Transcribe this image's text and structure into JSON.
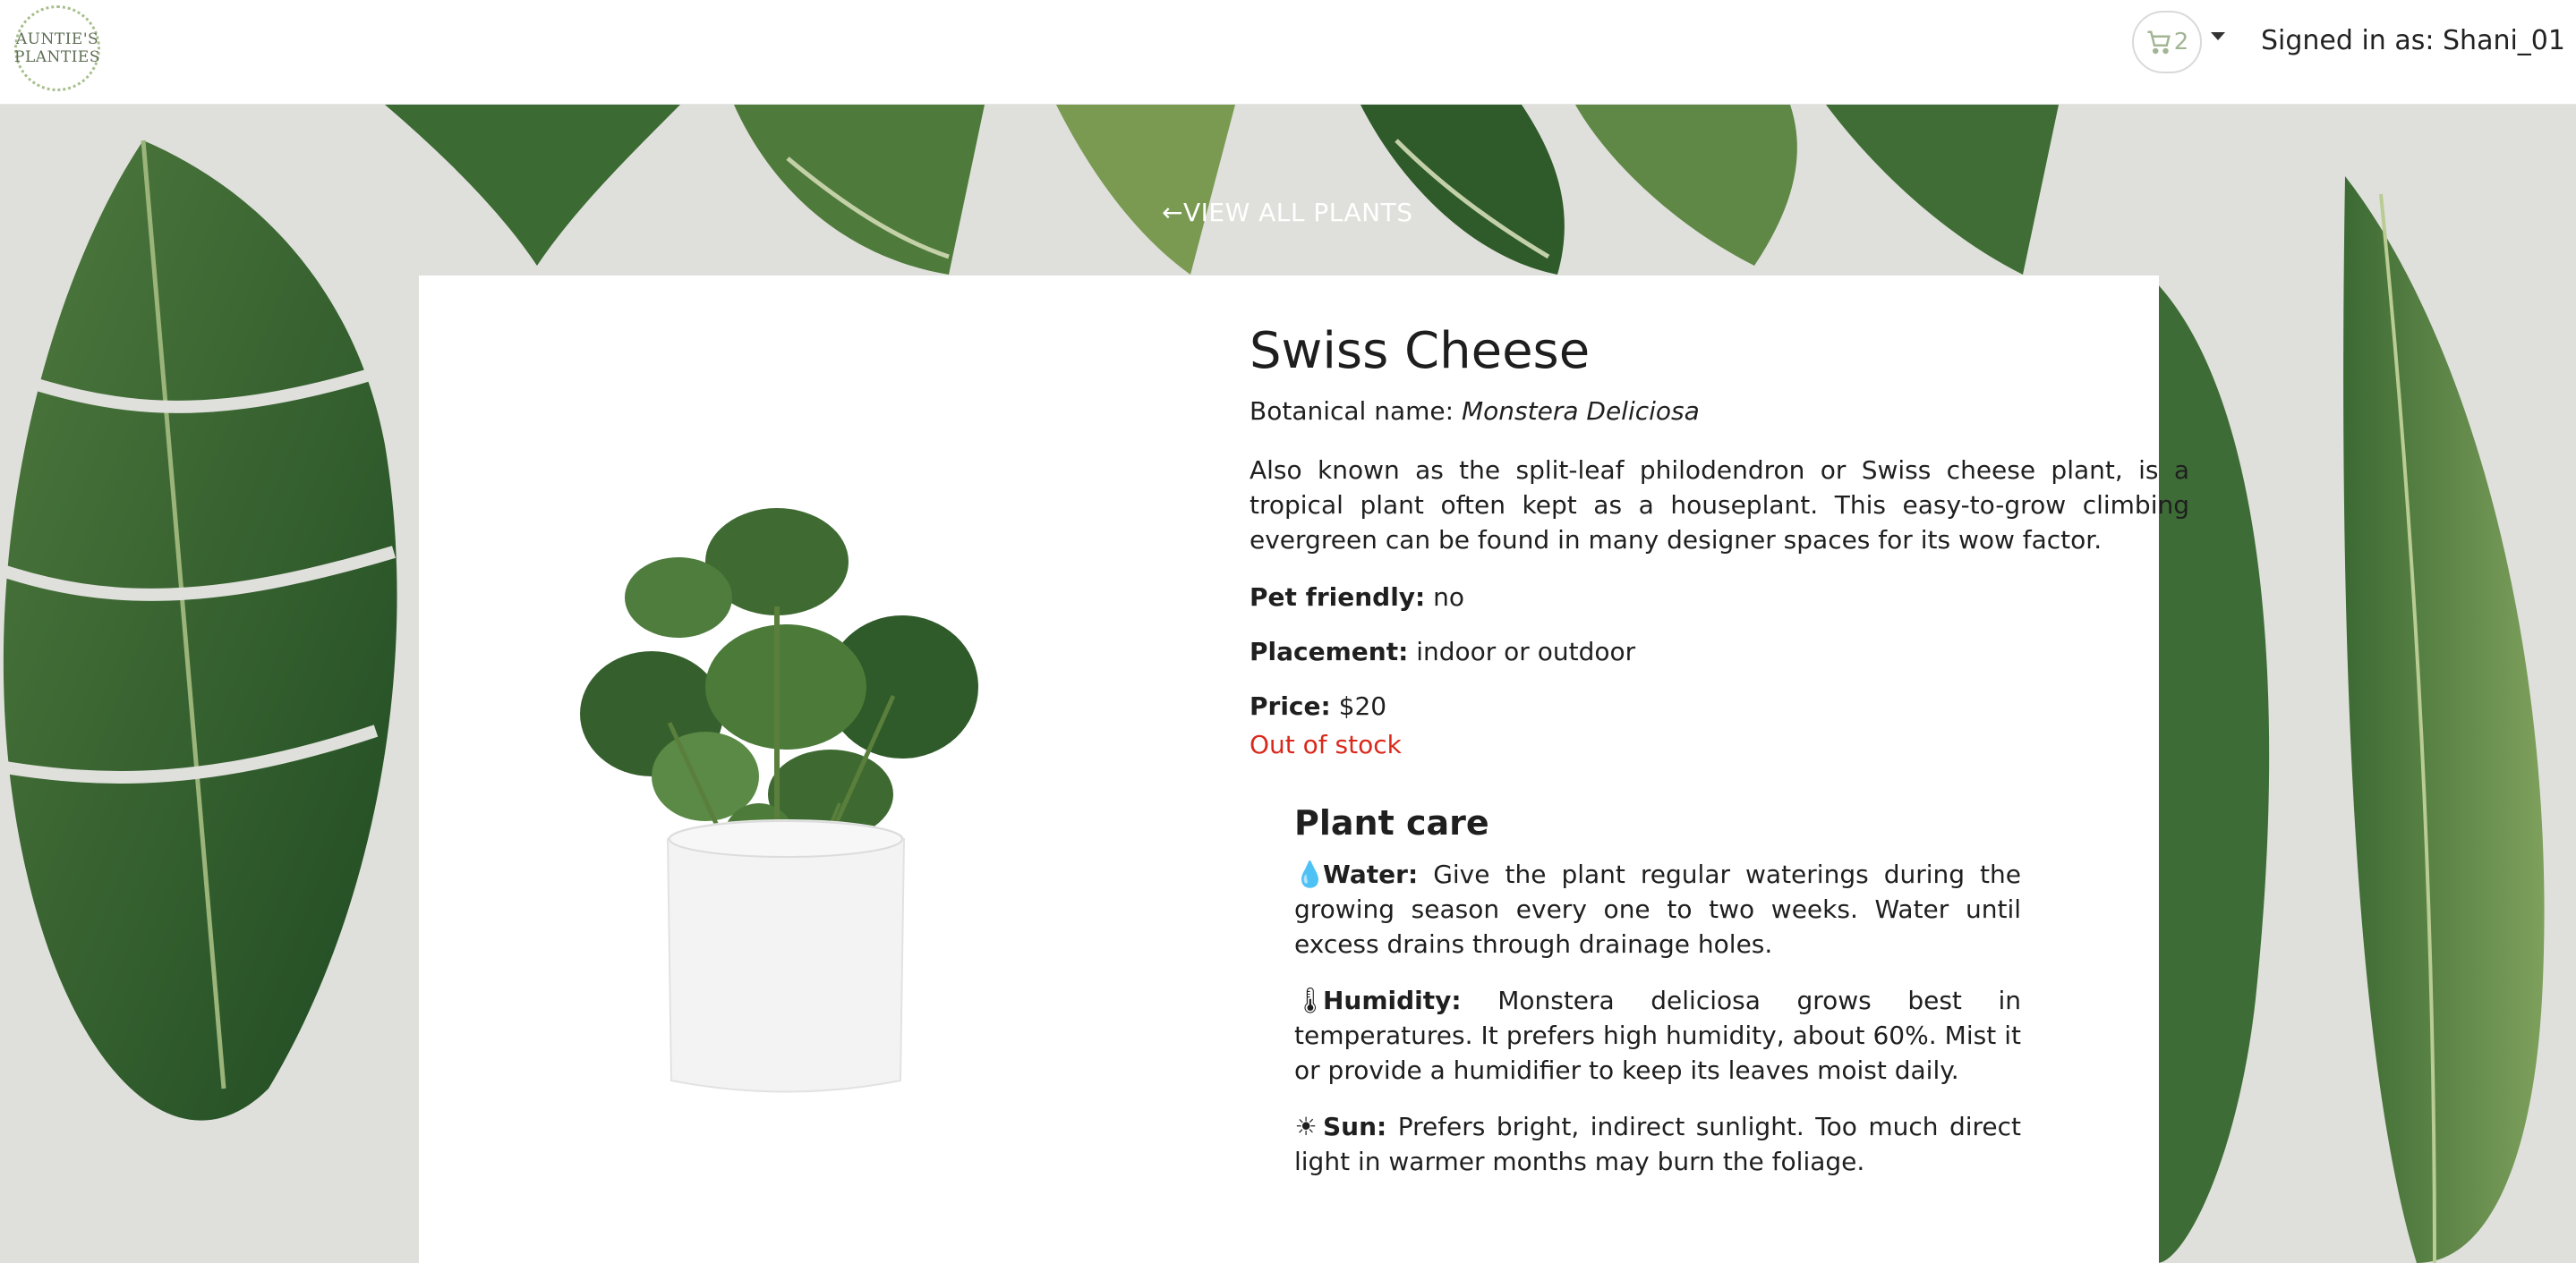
{
  "header": {
    "logo_line1": "AUNTIE'S",
    "logo_line2": "PLANTIES",
    "cart_icon": "cart-icon",
    "cart_count": "2",
    "signed_in": "Signed in as: Shani_01"
  },
  "nav": {
    "back_link": "←VIEW ALL PLANTS"
  },
  "product": {
    "name": "Swiss Cheese",
    "botanical_label": "Botanical name: ",
    "botanical_value": "Monstera Deliciosa",
    "description": "Also known as the split-leaf philodendron or Swiss cheese plant, is a tropical plant often kept as a houseplant. This easy-to-grow climbing evergreen can be found in many designer spaces for its wow factor.",
    "pet_label": "Pet friendly:",
    "pet_value": "no",
    "placement_label": "Placement:",
    "placement_value": "indoor or outdoor",
    "price_label": "Price:",
    "price_value": "$20",
    "stock": "Out of stock"
  },
  "care": {
    "title": "Plant care",
    "water_icon": "💧",
    "water_label": "Water:",
    "water_text": "Give the plant regular waterings during the growing season every one to two weeks. Water until excess drains through drainage holes.",
    "humidity_icon": "🌡",
    "humidity_label": "Humidity:",
    "humidity_text": "Monstera deliciosa grows best in temperatures. It prefers high humidity, about 60%. Mist it or provide a humidifier to keep its leaves moist daily.",
    "sun_icon": "☀",
    "sun_label": "Sun:",
    "sun_text": "Prefers bright, indirect sunlight. Too much direct light in warmer months may burn the foliage."
  },
  "colors": {
    "accent_green": "#a2b594",
    "stock_red": "#d9291c",
    "leaf_dark": "#2f5a2a",
    "wall": "#dfe0db"
  }
}
